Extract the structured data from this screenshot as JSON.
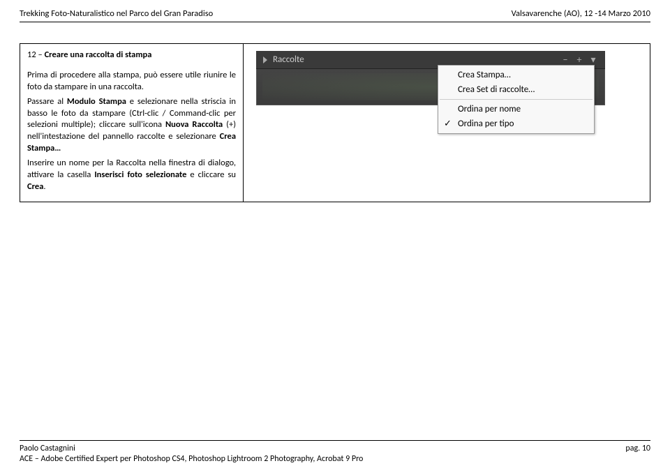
{
  "header": {
    "left": "Trekking Foto-Naturalistico nel Parco del Gran Paradiso",
    "right": "Valsavarenche (AO), 12 -14 Marzo 2010"
  },
  "step": {
    "number": "12",
    "dash": "–",
    "title": "Creare una raccolta di stampa",
    "p1a": "Prima di procedere alla stampa, può essere utile riunire le foto da stampare in una raccolta.",
    "p2a": "Passare al ",
    "p2b": "Modulo Stampa",
    "p2c": " e selezionare nella striscia in basso le foto da stampare (Ctrl-clic / Command-clic per selezioni multiple); cliccare sull'icona ",
    "p2d": "Nuova Raccolta",
    "p2e": " (+) nell'intestazione del pannello raccolte e selezionare ",
    "p2f": "Crea Stampa…",
    "p3a": "Inserire un nome per la Raccolta nella finestra di dialogo, attivare la casella ",
    "p3b": "Inserisci foto selezionate",
    "p3c": " e cliccare su ",
    "p3d": "Crea",
    "p3e": "."
  },
  "panel": {
    "title": "Raccolte",
    "minus": "−",
    "plus": "+",
    "chevron": "▾"
  },
  "menu": {
    "item1": "Crea Stampa…",
    "item2": "Crea Set di raccolte…",
    "item3": "Ordina per nome",
    "item4": "Ordina per tipo",
    "check": "✓"
  },
  "footer": {
    "author": "Paolo Castagnini",
    "cert": "ACE – Adobe Certified Expert per Photoshop CS4, Photoshop Lightroom 2 Photography, Acrobat 9 Pro",
    "page": "pag. 10"
  }
}
